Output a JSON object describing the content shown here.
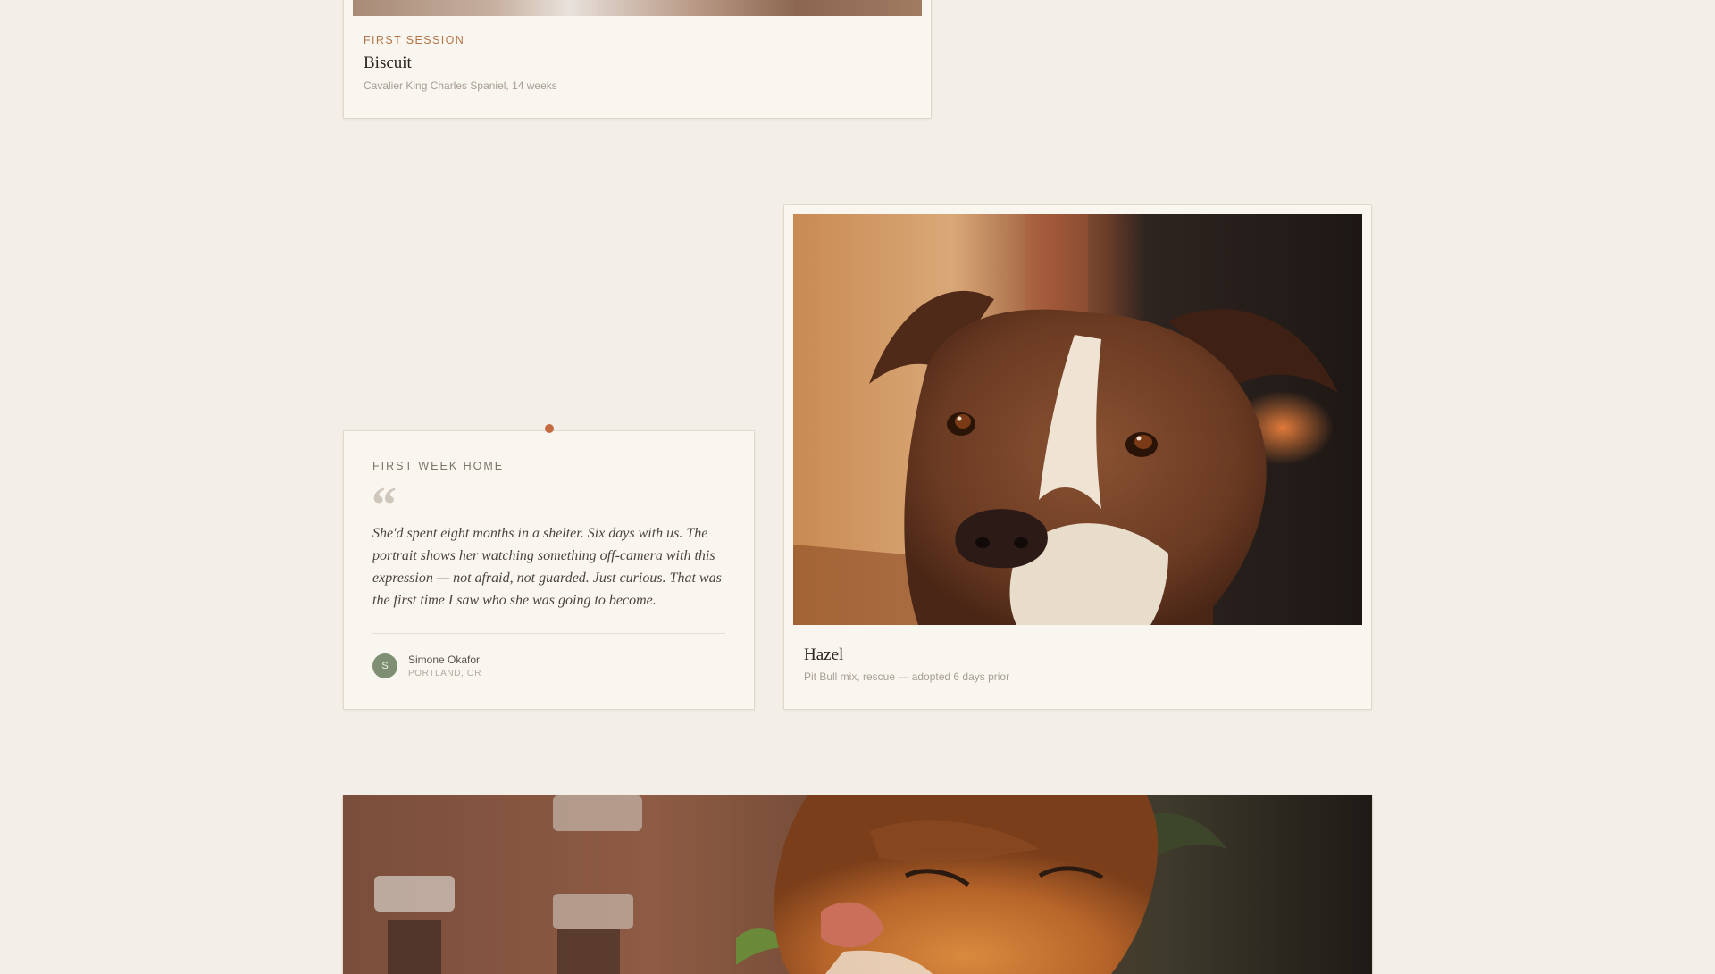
{
  "cards": {
    "biscuit": {
      "eyebrow": "FIRST SESSION",
      "name": "Biscuit",
      "meta": "Cavalier King Charles Spaniel, 14 weeks"
    },
    "quote": {
      "eyebrow": "FIRST WEEK HOME",
      "mark": "“",
      "text": "She'd spent eight months in a shelter. Six days with us. The portrait shows her watching something off-camera with this expression — not afraid, not guarded. Just curious. That was the first time I saw who she was going to become.",
      "author": {
        "initial": "S",
        "name": "Simone Okafor",
        "location": "PORTLAND, OR"
      }
    },
    "hazel": {
      "name": "Hazel",
      "meta": "Pit Bull mix, rescue — adopted 6 days prior"
    }
  },
  "colors": {
    "background": "#f3efe8",
    "card": "#f9f6f0",
    "accent": "#c46a3f",
    "eyebrow": "#b57447",
    "avatar": "#7f8f73"
  }
}
